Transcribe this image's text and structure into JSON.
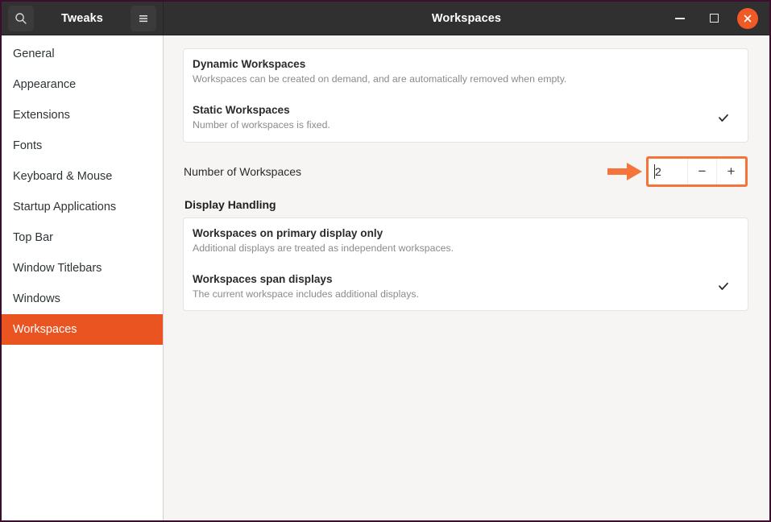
{
  "window": {
    "app_title": "Tweaks",
    "page_title": "Workspaces",
    "search_icon": "search-icon",
    "menu_icon": "hamburger-menu-icon",
    "minimize_label": "Minimize",
    "maximize_label": "Maximize",
    "close_label": "Close",
    "accent_color": "#e95420",
    "highlight_color": "#f4743b"
  },
  "sidebar": {
    "items": [
      {
        "label": "General",
        "selected": false
      },
      {
        "label": "Appearance",
        "selected": false
      },
      {
        "label": "Extensions",
        "selected": false
      },
      {
        "label": "Fonts",
        "selected": false
      },
      {
        "label": "Keyboard & Mouse",
        "selected": false
      },
      {
        "label": "Startup Applications",
        "selected": false
      },
      {
        "label": "Top Bar",
        "selected": false
      },
      {
        "label": "Window Titlebars",
        "selected": false
      },
      {
        "label": "Windows",
        "selected": false
      },
      {
        "label": "Workspaces",
        "selected": true
      }
    ]
  },
  "main": {
    "workspace_mode_card": [
      {
        "title": "Dynamic Workspaces",
        "subtitle": "Workspaces can be created on demand, and are automatically removed when empty.",
        "checked": false
      },
      {
        "title": "Static Workspaces",
        "subtitle": "Number of workspaces is fixed.",
        "checked": true
      }
    ],
    "number_of_workspaces": {
      "label": "Number of Workspaces",
      "value": "2",
      "decrement_label": "−",
      "increment_label": "+",
      "highlighted": true
    },
    "display_handling": {
      "heading": "Display Handling",
      "options": [
        {
          "title": "Workspaces on primary display only",
          "subtitle": "Additional displays are treated as independent workspaces.",
          "checked": false
        },
        {
          "title": "Workspaces span displays",
          "subtitle": "The current workspace includes additional displays.",
          "checked": true
        }
      ]
    }
  },
  "annotation": {
    "arrow": "right-arrow-annotation",
    "color": "#f4743b"
  }
}
